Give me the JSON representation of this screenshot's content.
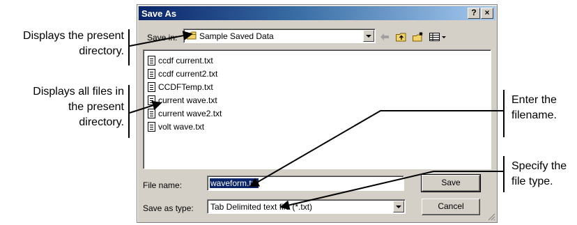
{
  "callouts": {
    "present_directory": [
      "Displays the present",
      "directory."
    ],
    "all_files": [
      "Displays all files in",
      "the present",
      "directory."
    ],
    "filename": [
      "Enter the",
      "filename."
    ],
    "file_type": [
      "Specify the",
      "file type."
    ]
  },
  "dialog": {
    "title": "Save As",
    "help_button": "?",
    "close_button": "×",
    "save_in_label": "Save in:",
    "save_in_value": "Sample Saved Data",
    "files": [
      "ccdf current.txt",
      "ccdf current2.txt",
      "CCDFTemp.txt",
      "current wave.txt",
      "current wave2.txt",
      "volt wave.txt"
    ],
    "file_name_label": "File name:",
    "file_name_value": "waveform.txt",
    "save_as_type_label": "Save as type:",
    "save_as_type_value": "Tab Delimited text file (*.txt)",
    "save_button": "Save",
    "cancel_button": "Cancel"
  },
  "icons": {
    "back": "back-arrow-icon",
    "up": "up-folder-icon",
    "new_folder": "new-folder-icon",
    "view_menu": "view-menu-icon",
    "folder": "folder-icon",
    "file": "text-file-icon"
  },
  "colors": {
    "titlebar_start": "#0a246a",
    "titlebar_end": "#a6caf0",
    "dialog_bg": "#d4d0c8",
    "selection": "#0a246a"
  }
}
